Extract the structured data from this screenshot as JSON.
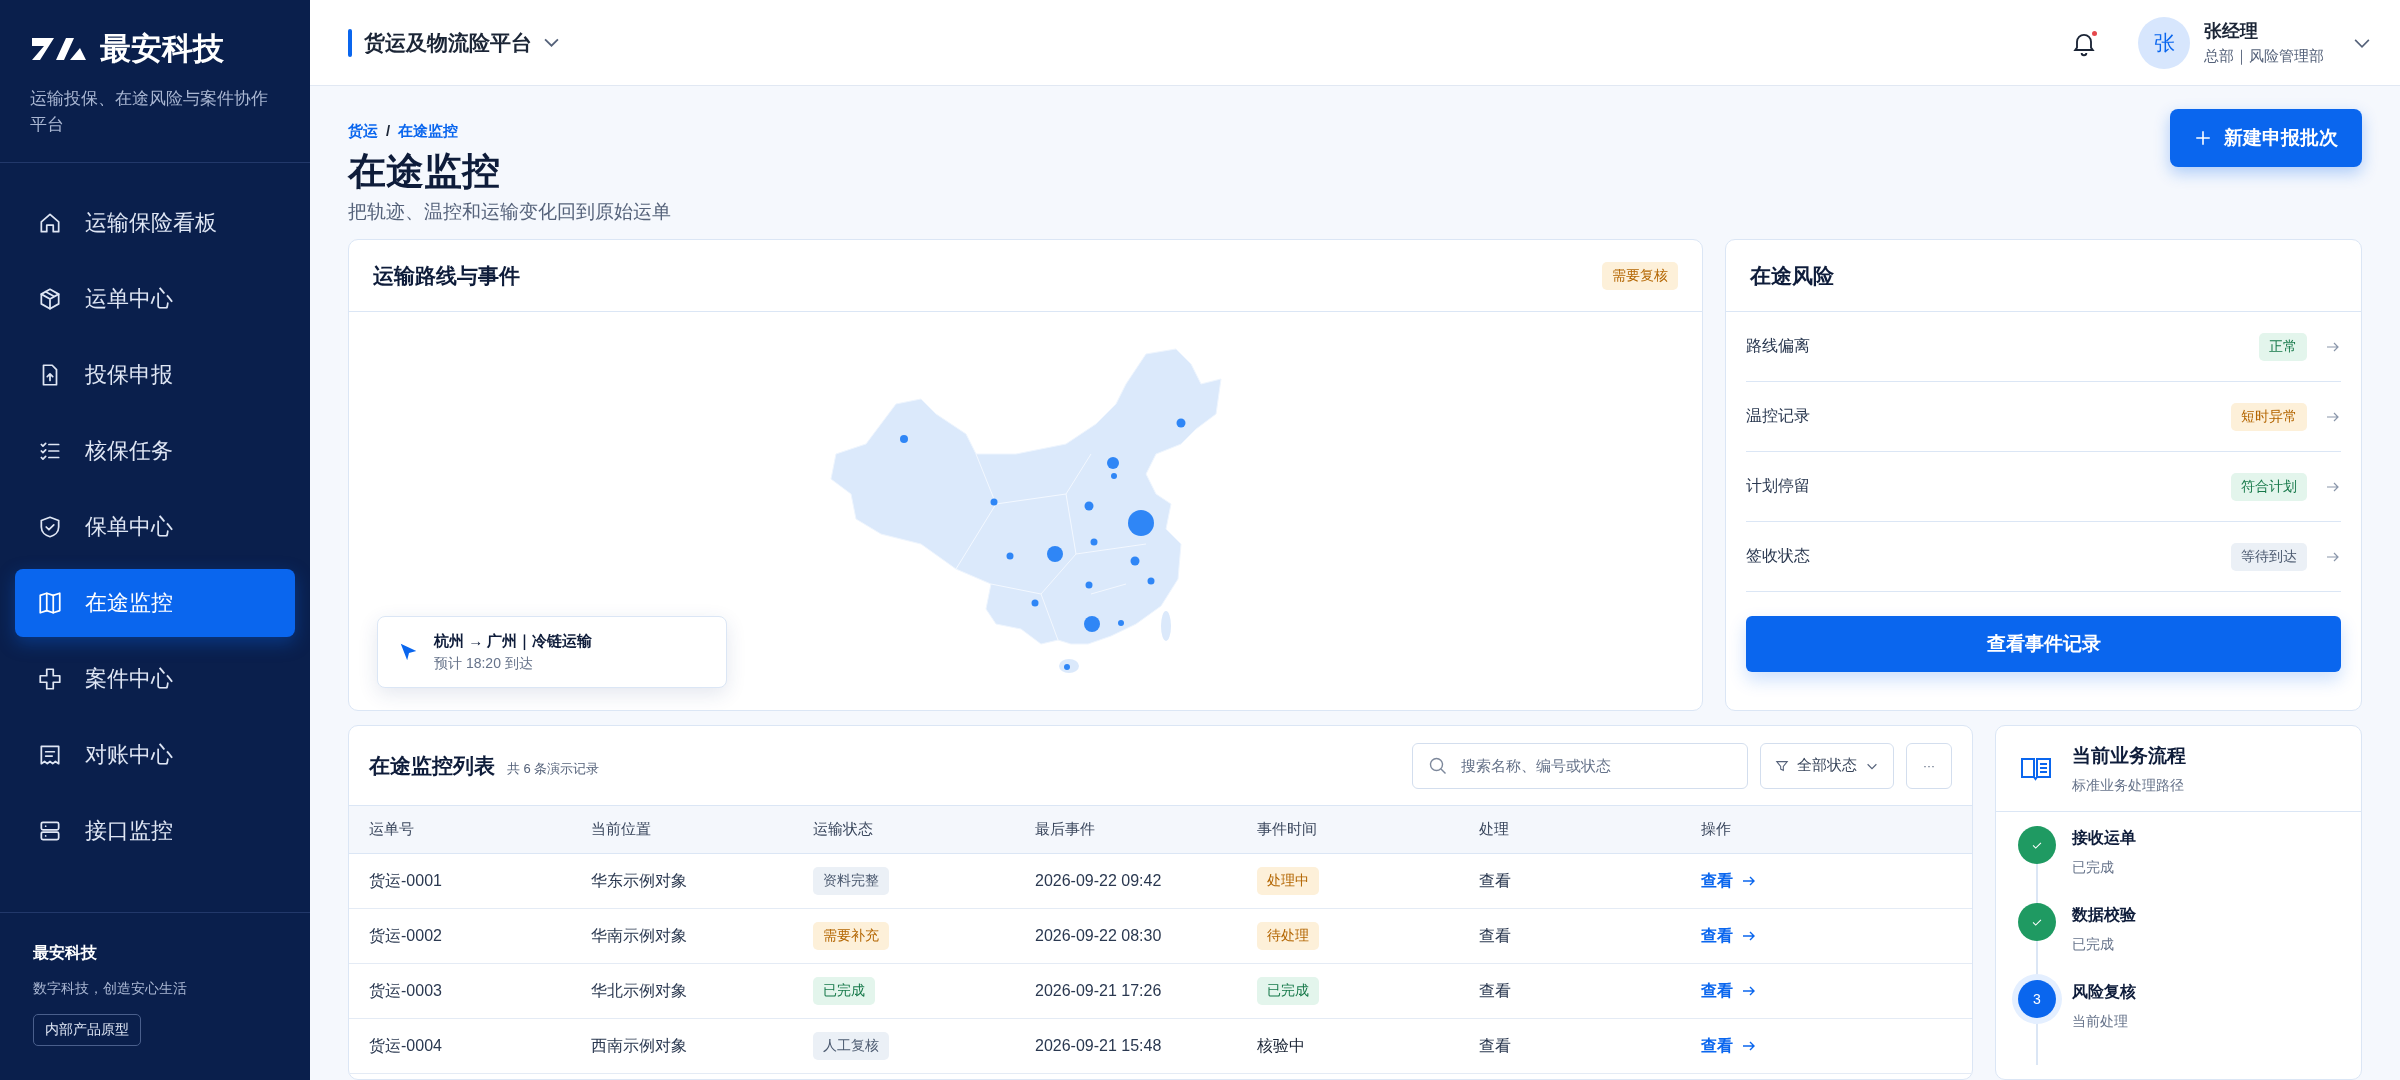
{
  "brand": {
    "name": "最安科技",
    "tagline": "运输投保、在途风险与案件协作平台"
  },
  "sidebar": {
    "items": [
      {
        "label": "运输保险看板",
        "selected": false
      },
      {
        "label": "运单中心",
        "selected": false
      },
      {
        "label": "投保申报",
        "selected": false
      },
      {
        "label": "核保任务",
        "selected": false
      },
      {
        "label": "保单中心",
        "selected": false
      },
      {
        "label": "在途监控",
        "selected": true
      },
      {
        "label": "案件中心",
        "selected": false
      },
      {
        "label": "对账中心",
        "selected": false
      },
      {
        "label": "接口监控",
        "selected": false
      }
    ],
    "footer": {
      "title": "最安科技",
      "slogan": "数字科技，创造安心生活",
      "badge": "内部产品原型"
    }
  },
  "topbar": {
    "platform": "货运及物流险平台",
    "notification_dot": true,
    "user": {
      "avatar": "张",
      "name": "张经理",
      "dept": "总部｜风险管理部"
    }
  },
  "page": {
    "breadcrumb": [
      "货运",
      "在途监控"
    ],
    "breadcrumb_separator": "/",
    "title": "在途监控",
    "subtitle": "把轨迹、温控和运输变化回到原始运单",
    "primary_button": "新建申报批次"
  },
  "route_card": {
    "title": "运输路线与事件",
    "tag": {
      "label": "需要复核",
      "kind": "warn"
    },
    "route": "杭州 → 广州｜冷链运输",
    "eta": "预计 18:20 到达"
  },
  "risk_card": {
    "title": "在途风险",
    "rows": [
      {
        "label": "路线偏离",
        "tag": "正常",
        "kind": "ok"
      },
      {
        "label": "温控记录",
        "tag": "短时异常",
        "kind": "warn"
      },
      {
        "label": "计划停留",
        "tag": "符合计划",
        "kind": "ok"
      },
      {
        "label": "签收状态",
        "tag": "等待到达",
        "kind": "neutral"
      }
    ],
    "button": "查看事件记录"
  },
  "table": {
    "title": "在途监控列表",
    "count": "共 6 条演示记录",
    "search": {
      "placeholder": "搜索名称、编号或状态"
    },
    "filter": "全部状态",
    "more": "···",
    "columns": [
      "运单号",
      "当前位置",
      "运输状态",
      "最后事件",
      "事件时间",
      "处理",
      "操作"
    ],
    "rows": [
      {
        "id": "货运-0001",
        "location": "华东示例对象",
        "status": {
          "label": "资料完整",
          "kind": "neutral"
        },
        "last_event": "2026-09-22 09:42",
        "event": {
          "label": "处理中",
          "kind": "warn"
        },
        "handle": "查看",
        "action": "查看"
      },
      {
        "id": "货运-0002",
        "location": "华南示例对象",
        "status": {
          "label": "需要补充",
          "kind": "warn"
        },
        "last_event": "2026-09-22 08:30",
        "event": {
          "label": "待处理",
          "kind": "warn"
        },
        "handle": "查看",
        "action": "查看"
      },
      {
        "id": "货运-0003",
        "location": "华北示例对象",
        "status": {
          "label": "已完成",
          "kind": "ok"
        },
        "last_event": "2026-09-21 17:26",
        "event": {
          "label": "已完成",
          "kind": "ok"
        },
        "handle": "查看",
        "action": "查看"
      },
      {
        "id": "货运-0004",
        "location": "西南示例对象",
        "status": {
          "label": "人工复核",
          "kind": "neutral"
        },
        "last_event": "2026-09-21 15:48",
        "event": {
          "label": "核验中",
          "kind": "plain"
        },
        "handle": "查看",
        "action": "查看"
      }
    ]
  },
  "process": {
    "title": "当前业务流程",
    "subtitle": "标准业务处理路径",
    "steps": [
      {
        "title": "接收运单",
        "note": "已完成",
        "completed": true,
        "current": false
      },
      {
        "title": "数据校验",
        "note": "已完成",
        "completed": true,
        "current": false
      },
      {
        "title": "风险复核",
        "note": "当前处理",
        "completed": false,
        "current": true,
        "marker": "3"
      }
    ]
  }
}
